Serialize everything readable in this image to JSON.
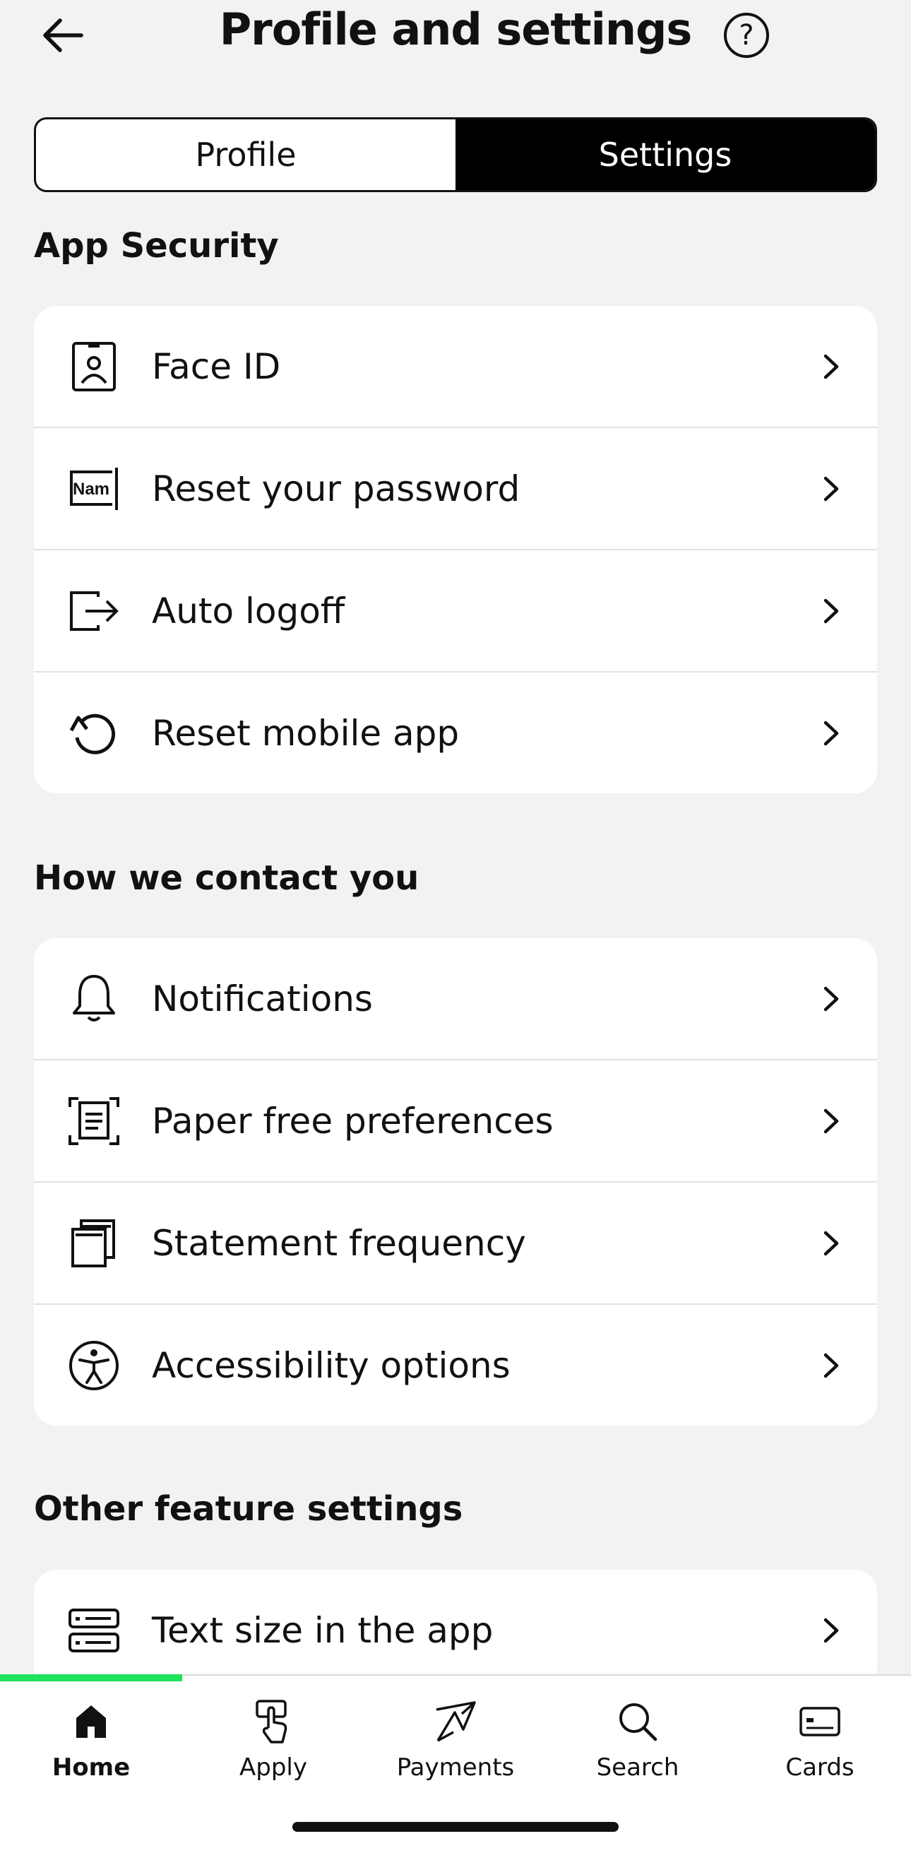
{
  "header": {
    "title": "Profile and settings",
    "help_glyph": "?"
  },
  "segmented": {
    "profile": "Profile",
    "settings": "Settings",
    "selected": "Settings"
  },
  "sections": {
    "app_security": {
      "title": "App Security",
      "items": [
        {
          "label": "Face ID",
          "icon": "face-id-icon"
        },
        {
          "label": "Reset your password",
          "icon": "password-field-icon",
          "icon_text": "Nam"
        },
        {
          "label": "Auto logoff",
          "icon": "logout-icon"
        },
        {
          "label": "Reset mobile app",
          "icon": "reset-icon"
        }
      ]
    },
    "contact": {
      "title": "How we contact you",
      "items": [
        {
          "label": "Notifications",
          "icon": "bell-icon"
        },
        {
          "label": "Paper free preferences",
          "icon": "paper-free-icon"
        },
        {
          "label": "Statement frequency",
          "icon": "statements-icon"
        },
        {
          "label": "Accessibility options",
          "icon": "accessibility-icon"
        }
      ]
    },
    "other": {
      "title": "Other feature settings",
      "items": [
        {
          "label": "Text size in the app",
          "icon": "text-size-icon"
        }
      ]
    }
  },
  "tabbar": {
    "active": "Home",
    "progress_fraction": 0.2,
    "accent_color": "#1fe35a",
    "items": [
      {
        "label": "Home",
        "icon": "home-icon"
      },
      {
        "label": "Apply",
        "icon": "apply-icon"
      },
      {
        "label": "Payments",
        "icon": "payments-icon"
      },
      {
        "label": "Search",
        "icon": "search-icon"
      },
      {
        "label": "Cards",
        "icon": "card-icon"
      }
    ]
  }
}
